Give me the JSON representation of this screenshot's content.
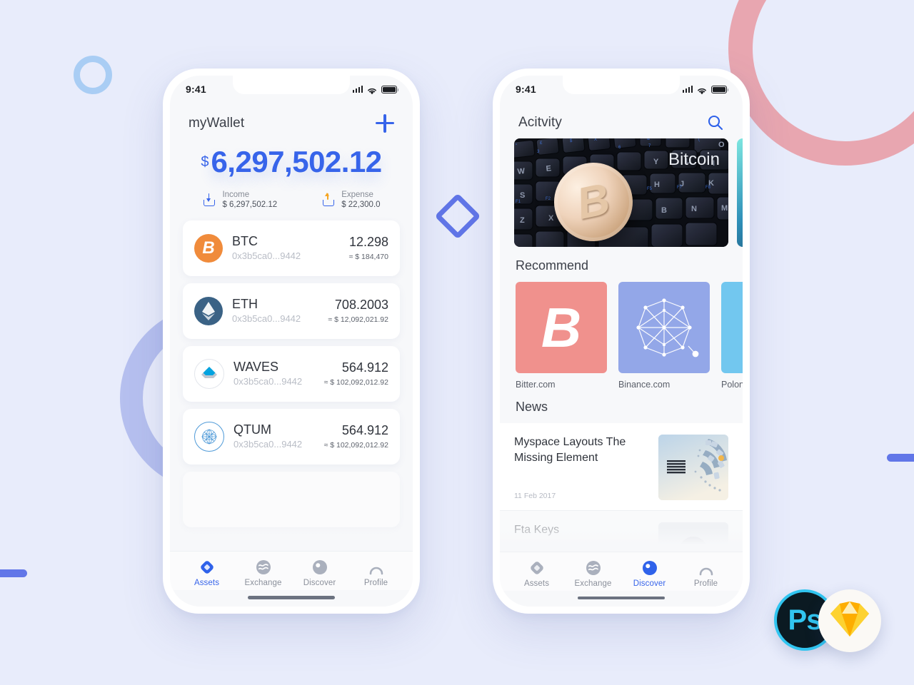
{
  "wallet": {
    "status": {
      "time": "9:41"
    },
    "header": {
      "title": "myWallet",
      "add_icon": "plus-icon"
    },
    "balance": {
      "currency": "$",
      "amount": "6,297,502.12"
    },
    "income": {
      "icon": "download-tray-icon",
      "label": "Income",
      "value": "$ 6,297,502.12"
    },
    "expense": {
      "icon": "upload-tray-icon",
      "label": "Expense",
      "value": "$ 22,300.0"
    },
    "assets": [
      {
        "symbol": "BTC",
        "address": "0x3b5ca0...9442",
        "amount": "12.298",
        "usd": "≈ $ 184,470",
        "icon": "bitcoin-coin-icon"
      },
      {
        "symbol": "ETH",
        "address": "0x3b5ca0...9442",
        "amount": "708.2003",
        "usd": "≈ $ 12,092,021.92",
        "icon": "ethereum-coin-icon"
      },
      {
        "symbol": "WAVES",
        "address": "0x3b5ca0...9442",
        "amount": "564.912",
        "usd": "≈ $ 102,092,012.92",
        "icon": "waves-coin-icon"
      },
      {
        "symbol": "QTUM",
        "address": "0x3b5ca0...9442",
        "amount": "564.912",
        "usd": "≈ $ 102,092,012.92",
        "icon": "qtum-coin-icon"
      }
    ],
    "tabs": [
      {
        "label": "Assets",
        "icon": "diamond-icon",
        "active": true
      },
      {
        "label": "Exchange",
        "icon": "waves-icon",
        "active": false
      },
      {
        "label": "Discover",
        "icon": "compass-icon",
        "active": false
      },
      {
        "label": "Profile",
        "icon": "person-icon",
        "active": false
      }
    ]
  },
  "discover": {
    "status": {
      "time": "9:41"
    },
    "header": {
      "title": "Acitvity",
      "search_icon": "search-icon"
    },
    "hero": [
      {
        "caption": "Bitcoin"
      },
      {
        "caption": ""
      }
    ],
    "recommend": {
      "title": "Recommend",
      "items": [
        {
          "label": "Bitter.com",
          "icon": "bitcoin-glyph-icon",
          "color": "#f0918d"
        },
        {
          "label": "Binance.com",
          "icon": "network-graph-icon",
          "color": "#93a7e8"
        },
        {
          "label": "Polonie",
          "icon": "poloniex-icon",
          "color": "#72c7ef"
        }
      ]
    },
    "news": {
      "title": "News",
      "items": [
        {
          "title": "Myspace Layouts The Missing Element",
          "date": "11 Feb 2017",
          "thumb": "ibm-server-thumb"
        },
        {
          "title": "Fta Keys",
          "date": "",
          "thumb": "portrait-thumb"
        }
      ]
    },
    "tabs": [
      {
        "label": "Assets",
        "icon": "diamond-icon",
        "active": false
      },
      {
        "label": "Exchange",
        "icon": "waves-icon",
        "active": false
      },
      {
        "label": "Discover",
        "icon": "compass-icon",
        "active": true
      },
      {
        "label": "Profile",
        "icon": "person-icon",
        "active": false
      }
    ]
  },
  "badges": {
    "photoshop": {
      "label": "Ps",
      "name": "photoshop-badge"
    },
    "sketch": {
      "label": "",
      "name": "sketch-badge"
    }
  }
}
